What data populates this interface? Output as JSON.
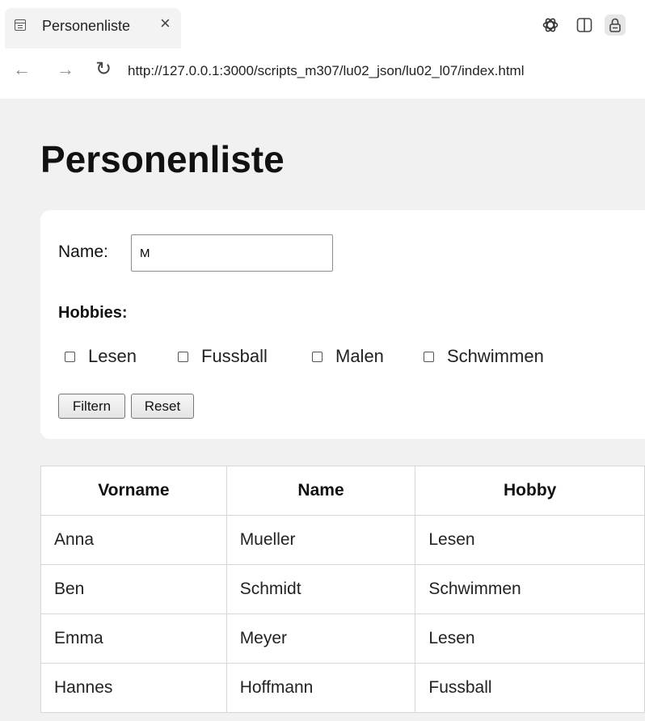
{
  "browser": {
    "tab_title": "Personenliste",
    "tab_close": "×",
    "url": "http://127.0.0.1:3000/scripts_m307/lu02_json/lu02_l07/index.html",
    "nav": {
      "back": "←",
      "forward": "→",
      "reload": "↻"
    },
    "icons": [
      "tab-page-icon",
      "chatgpt-icon",
      "split-view-icon",
      "lock-icon"
    ]
  },
  "page": {
    "title": "Personenliste",
    "filter": {
      "name_label": "Name:",
      "name_value": "M",
      "hobbies_label": "Hobbies:",
      "hobbies": [
        {
          "label": "Lesen",
          "checked": false
        },
        {
          "label": "Fussball",
          "checked": false
        },
        {
          "label": "Malen",
          "checked": false
        },
        {
          "label": "Schwimmen",
          "checked": false
        }
      ],
      "filter_button": "Filtern",
      "reset_button": "Reset"
    },
    "table": {
      "headers": [
        "Vorname",
        "Name",
        "Hobby"
      ],
      "rows": [
        [
          "Anna",
          "Mueller",
          "Lesen"
        ],
        [
          "Ben",
          "Schmidt",
          "Schwimmen"
        ],
        [
          "Emma",
          "Meyer",
          "Lesen"
        ],
        [
          "Hannes",
          "Hoffmann",
          "Fussball"
        ]
      ]
    }
  }
}
